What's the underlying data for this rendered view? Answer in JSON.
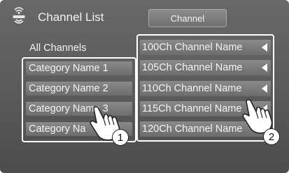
{
  "header": {
    "logo_icon": "siriusxm-logo",
    "title": "Channel List",
    "tab_label": "Channel"
  },
  "all_channels_label": "All Channels",
  "categories": [
    {
      "label": "Category Name 1"
    },
    {
      "label": "Category Name 2"
    },
    {
      "label": "Category Name 3"
    },
    {
      "label": "Category Na"
    }
  ],
  "channels": [
    {
      "label": "100Ch Channel Name"
    },
    {
      "label": "105Ch Channel Name"
    },
    {
      "label": "110Ch Channel Name"
    },
    {
      "label": "115Ch Channel Name"
    },
    {
      "label": "120Ch Channel Name"
    }
  ],
  "callouts": [
    {
      "label": "1",
      "icon": "pointing-hand-icon"
    },
    {
      "label": "2",
      "icon": "pointing-hand-icon"
    }
  ],
  "colors": {
    "background": "#5f5f5f",
    "button": "#7c7c7c",
    "highlight": "#ffffff",
    "text": "#f2f2f2"
  }
}
